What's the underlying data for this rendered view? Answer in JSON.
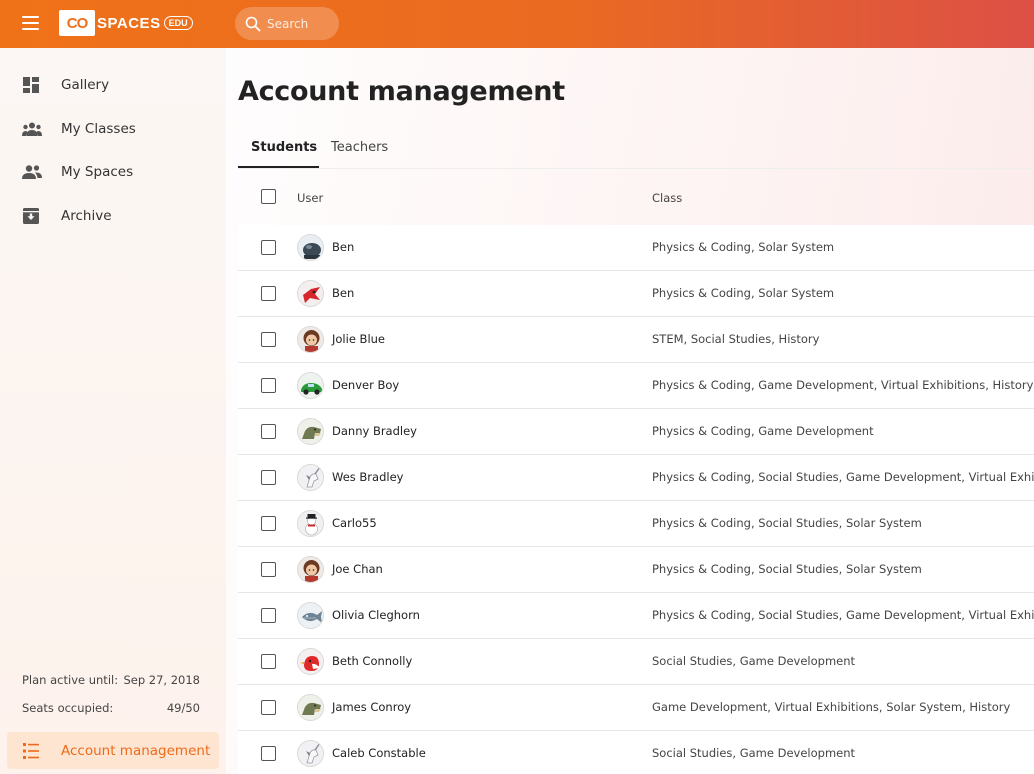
{
  "header": {
    "logo_box": "CO",
    "logo_text": "SPACES",
    "logo_edu": "EDU",
    "search_placeholder": "Search"
  },
  "sidebar": {
    "items": [
      {
        "label": "Gallery",
        "icon": "grid-icon"
      },
      {
        "label": "My Classes",
        "icon": "group-icon"
      },
      {
        "label": "My Spaces",
        "icon": "people-icon"
      },
      {
        "label": "Archive",
        "icon": "archive-icon"
      }
    ],
    "plan_label": "Plan active until:",
    "plan_value": "Sep 27, 2018",
    "seats_label": "Seats occupied:",
    "seats_value": "49/50",
    "account_label": "Account management",
    "account_icon": "list-icon"
  },
  "main": {
    "title": "Account management",
    "tabs": [
      {
        "label": "Students",
        "active": true
      },
      {
        "label": "Teachers",
        "active": false
      }
    ],
    "columns": {
      "user": "User",
      "class": "Class"
    },
    "rows": [
      {
        "name": "Ben",
        "classes": "Physics & Coding, Solar System",
        "avatar": "dark-robot"
      },
      {
        "name": "Ben",
        "classes": "Physics & Coding, Solar System",
        "avatar": "red-dragon"
      },
      {
        "name": "Jolie Blue",
        "classes": "STEM, Social Studies, History",
        "avatar": "girl"
      },
      {
        "name": "Denver Boy",
        "classes": "Physics & Coding, Game Development, Virtual Exhibitions, History, Liter",
        "avatar": "green-car"
      },
      {
        "name": "Danny Bradley",
        "classes": "Physics & Coding, Game Development",
        "avatar": "dinosaur"
      },
      {
        "name": "Wes Bradley",
        "classes": "Physics & Coding, Social Studies, Game Development, Virtual Exhibitio",
        "avatar": "unicorn"
      },
      {
        "name": "Carlo55",
        "classes": "Physics & Coding, Social Studies, Solar System",
        "avatar": "snowman"
      },
      {
        "name": "Joe Chan",
        "classes": "Physics & Coding, Social Studies, Solar System",
        "avatar": "girl"
      },
      {
        "name": "Olivia Cleghorn",
        "classes": "Physics & Coding, Social Studies, Game Development, Virtual Exhibitio",
        "avatar": "fish"
      },
      {
        "name": "Beth Connolly",
        "classes": "Social Studies, Game Development",
        "avatar": "red-bird"
      },
      {
        "name": "James Conroy",
        "classes": "Game Development, Virtual Exhibitions, Solar System, History",
        "avatar": "dinosaur"
      },
      {
        "name": "Caleb Constable",
        "classes": "Social Studies, Game Development",
        "avatar": "unicorn"
      }
    ]
  },
  "colors": {
    "accent": "#ee6a1a",
    "header_start": "#f07218",
    "header_end": "#dc5046",
    "account_bg": "#fde5d2"
  }
}
